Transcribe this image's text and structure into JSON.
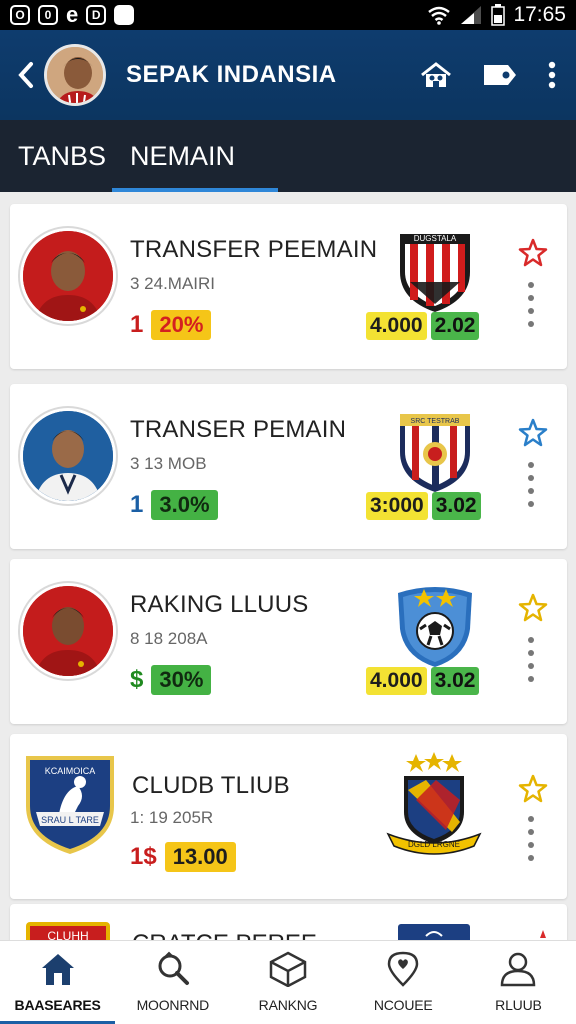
{
  "status_bar": {
    "time": "17:65",
    "left_icons": [
      "O",
      "0",
      "e",
      "D",
      "■"
    ]
  },
  "header": {
    "title": "SEPAK INDANSIA",
    "back_icon": "chevron-left-icon",
    "actions": [
      "team-icon",
      "tag-icon",
      "more-vert-icon"
    ]
  },
  "tabs": [
    {
      "label": "TANBS",
      "active": false
    },
    {
      "label": "NEMAIN",
      "active": true
    }
  ],
  "cards": [
    {
      "title": "TRANSFER PEEMAIN",
      "sub": "3 24.MAIRI",
      "pct_num": "1",
      "pct_num_color": "#c81e1e",
      "pct": "20%",
      "pct_style": "y",
      "crest_text": "DUGSTALA",
      "crest_type": "red-stripes",
      "score1": "4.000",
      "score2": "2.02",
      "star_color": "#d92a2a",
      "avatar_bg": "#c41c1c"
    },
    {
      "title": "TRANSER PEMAIN",
      "sub": "3 13 MOB",
      "pct_num": "1",
      "pct_num_color": "#1b5fa5",
      "pct": "3.0%",
      "pct_style": "g",
      "crest_text": "SRC TESTRAB",
      "crest_type": "navy-stripes",
      "score1": "3:000",
      "score2": "3.02",
      "star_color": "#2a7fc9",
      "avatar_bg": "#1f5fa0"
    },
    {
      "title": "RAKING LLUUS",
      "sub": "8 18 208A",
      "pct_num": "$",
      "pct_num_color": "#208a20",
      "pct": "30%",
      "pct_style": "g",
      "crest_text": "",
      "crest_type": "ball-shield",
      "score1": "4.000",
      "score2": "3.02",
      "star_color": "#e5b400",
      "avatar_bg": "#c41c1c"
    },
    {
      "title": "CLUDB TLIUB",
      "sub": "1: 19 205R",
      "pct_num": "1$",
      "pct_num_color": "#c81e1e",
      "pct": "13.00",
      "pct_style": "y",
      "crest_text": "DGLD LRGNE",
      "crest_type": "ribbon",
      "score1": "",
      "score2": "",
      "star_color": "#e5b400",
      "avatar_bg": "#ffffff",
      "avatar_text": "KCAIMOICA",
      "avatar_text2": "SRAU L TARE"
    }
  ],
  "partial_card": {
    "title": "CRATCE PEREE",
    "crest_text": "CLUHH"
  },
  "bottom_nav": [
    {
      "label": "BAASEARES",
      "icon": "home-icon",
      "active": true
    },
    {
      "label": "MOONRND",
      "icon": "search-icon",
      "active": false
    },
    {
      "label": "RANKNG",
      "icon": "box-icon",
      "active": false
    },
    {
      "label": "NCOUEE",
      "icon": "location-icon",
      "active": false
    },
    {
      "label": "RLUUB",
      "icon": "person-icon",
      "active": false
    }
  ]
}
